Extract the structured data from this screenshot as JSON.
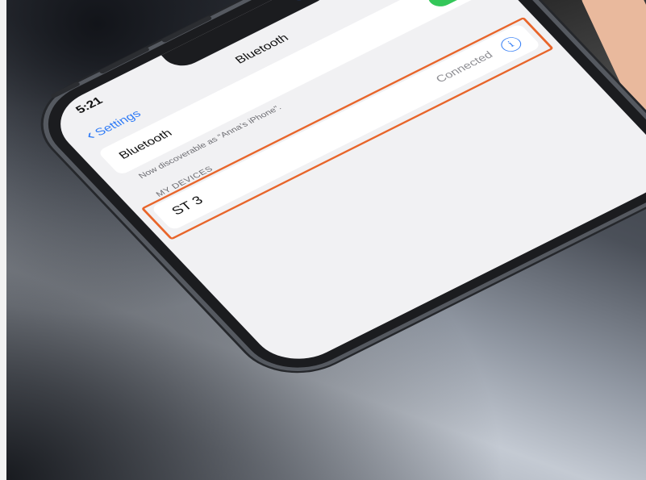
{
  "status_bar": {
    "time": "5:21",
    "signal": "∷′",
    "wifi": "◠"
  },
  "nav": {
    "back_label": "Settings",
    "title": "Bluetooth"
  },
  "bluetooth": {
    "label": "Bluetooth",
    "enabled": true,
    "discoverable_text": "Now discoverable as “Anna’s iPhone”."
  },
  "my_devices": {
    "section_label": "MY DEVICES",
    "items": [
      {
        "name": "ST 3",
        "status": "Connected",
        "info": "i"
      }
    ]
  },
  "colors": {
    "accent": "#2f7bf6",
    "toggle_on": "#34c759",
    "highlight": "#e8652a"
  }
}
